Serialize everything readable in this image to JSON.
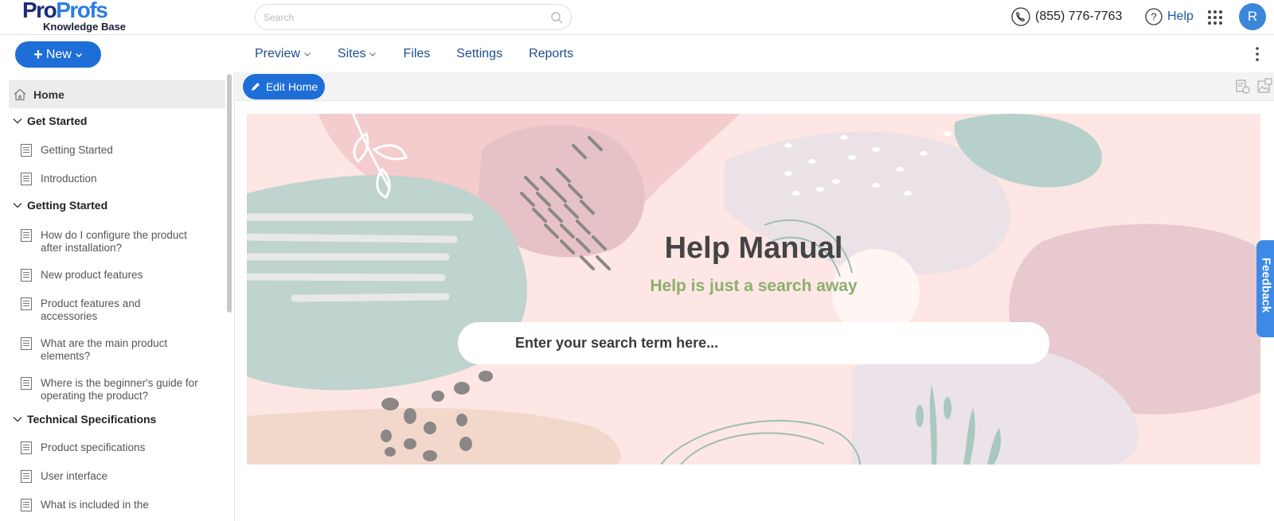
{
  "header": {
    "logo_part1": "Pro",
    "logo_part2": "Profs",
    "logo_sub": "Knowledge Base",
    "search_placeholder": "Search",
    "phone": "(855) 776-7763",
    "help": "Help",
    "avatar_initial": "R"
  },
  "toolbar": {
    "new_label": "New",
    "nav": [
      {
        "label": "Preview",
        "has_dropdown": true
      },
      {
        "label": "Sites",
        "has_dropdown": true
      },
      {
        "label": "Files",
        "has_dropdown": false
      },
      {
        "label": "Settings",
        "has_dropdown": false
      },
      {
        "label": "Reports",
        "has_dropdown": false
      }
    ],
    "edit_home": "Edit Home"
  },
  "sidebar": {
    "home": "Home",
    "categories": [
      {
        "title": "Get Started",
        "articles": [
          "Getting Started",
          "Introduction"
        ]
      },
      {
        "title": "Getting Started",
        "articles": [
          "How do I configure the product after installation?",
          "New product features",
          "Product features and accessories",
          "What are the main product elements?",
          "Where is the beginner's guide for operating the product?"
        ]
      },
      {
        "title": "Technical Specifications",
        "articles": [
          "Product specifications",
          "User interface",
          "What is included in the"
        ]
      }
    ]
  },
  "hero": {
    "title": "Help Manual",
    "subtitle": "Help is just a search away",
    "search_placeholder": "Enter your search term here..."
  },
  "feedback": "Feedback",
  "colors": {
    "primary": "#1d6ed6",
    "link": "#1f4e8c",
    "subtitle": "#8caf6e",
    "feedback": "#3c8ae6"
  }
}
